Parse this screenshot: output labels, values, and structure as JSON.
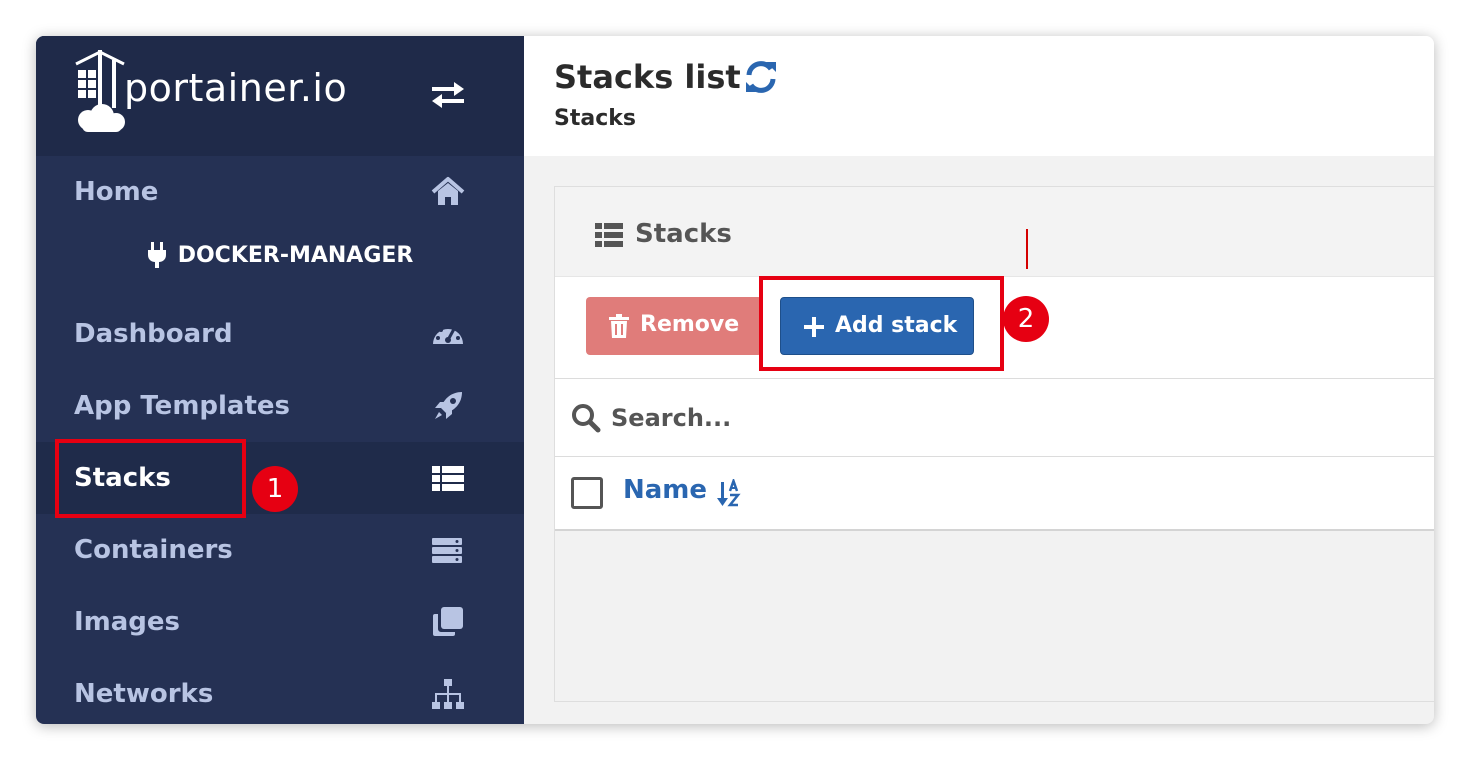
{
  "brand": {
    "name": "portainer.io"
  },
  "sidebar": {
    "home": "Home",
    "endpoint": "DOCKER-MANAGER",
    "items": [
      {
        "label": "Dashboard",
        "icon": "tachometer-icon"
      },
      {
        "label": "App Templates",
        "icon": "rocket-icon"
      },
      {
        "label": "Stacks",
        "icon": "th-list-icon",
        "active": true
      },
      {
        "label": "Containers",
        "icon": "server-icon"
      },
      {
        "label": "Images",
        "icon": "clone-icon"
      },
      {
        "label": "Networks",
        "icon": "sitemap-icon"
      }
    ]
  },
  "header": {
    "title": "Stacks list",
    "breadcrumb": "Stacks"
  },
  "widget": {
    "title": "Stacks",
    "remove_label": "Remove",
    "add_label": "Add stack",
    "search_placeholder": "Search...",
    "columns": [
      {
        "label": "Name"
      }
    ]
  },
  "annotations": {
    "marker_1": "1",
    "marker_2": "2"
  },
  "colors": {
    "sidebar_bg": "#253154",
    "accent_blue": "#2a66b0",
    "danger": "#e07c7a",
    "annotation_red": "#e60012"
  }
}
